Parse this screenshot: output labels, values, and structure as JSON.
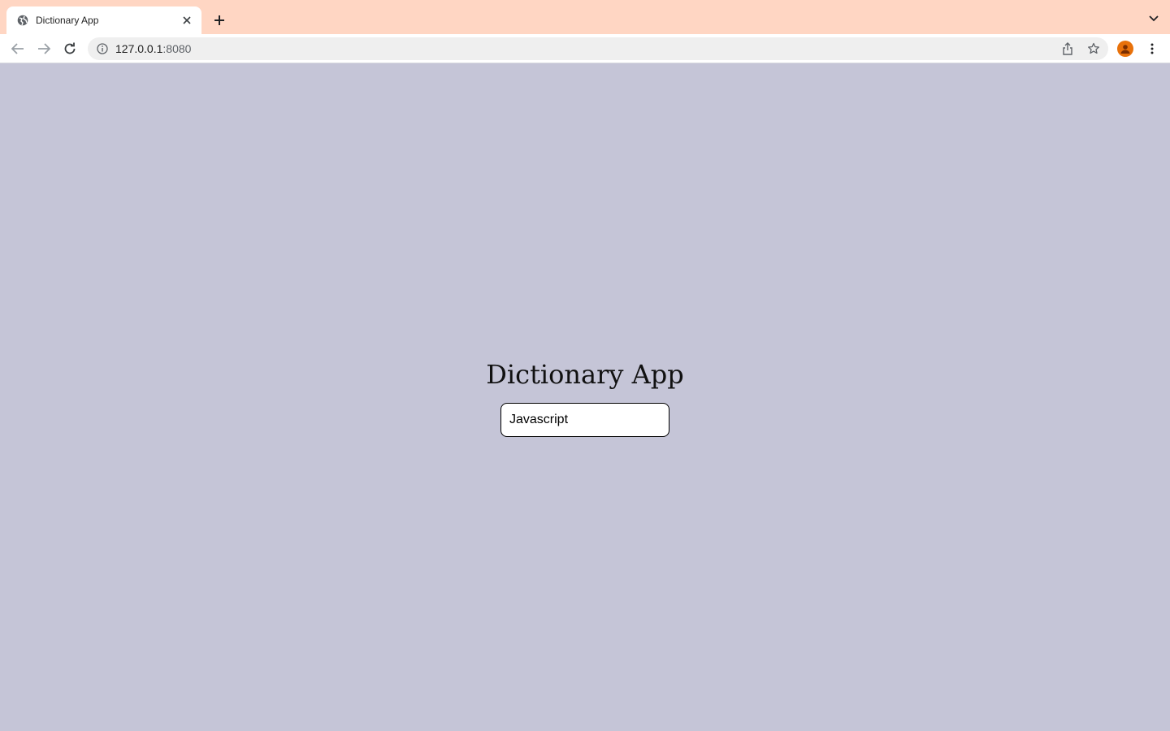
{
  "browser": {
    "tab": {
      "title": "Dictionary App",
      "favicon": "globe-icon",
      "close": "close-icon"
    },
    "new_tab": "plus-icon",
    "tab_list": "chevron-down-icon",
    "toolbar": {
      "back": "arrow-left-icon",
      "forward": "arrow-right-icon",
      "reload": "reload-icon",
      "url_host": "127.0.0.1",
      "url_port": ":8080",
      "share": "share-icon",
      "bookmark": "star-icon",
      "profile": "profile-icon",
      "menu": "kebab-menu-icon"
    },
    "colors": {
      "tabstrip": "#ffd6c3",
      "page_background": "#c5c5d7",
      "profile": "#e8710a"
    }
  },
  "app": {
    "title": "Dictionary App",
    "search": {
      "value": "Javascript"
    }
  }
}
